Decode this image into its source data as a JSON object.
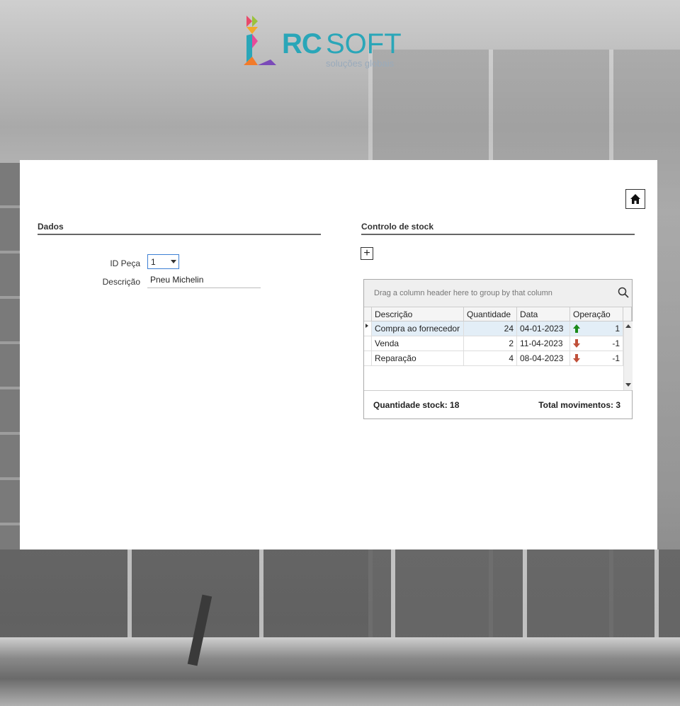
{
  "logo": {
    "rc": "RC",
    "soft": "SOFT",
    "tagline": "soluções globais"
  },
  "left": {
    "section_title": "Dados",
    "id_label": "ID Peça",
    "id_value": "1",
    "descricao_label": "Descrição",
    "descricao_value": "Pneu Michelin"
  },
  "right": {
    "section_title": "Controlo de stock",
    "add_button_label": "+",
    "grid": {
      "group_hint": "Drag a column header here to group by that column",
      "columns": [
        "Descrição",
        "Quantidade",
        "Data",
        "Operação"
      ],
      "rows": [
        {
          "descricao": "Compra ao fornecedor",
          "quantidade": "24",
          "data": "04-01-2023",
          "operacao": "1",
          "direction": "up"
        },
        {
          "descricao": "Venda",
          "quantidade": "2",
          "data": "11-04-2023",
          "operacao": "-1",
          "direction": "down"
        },
        {
          "descricao": "Reparação",
          "quantidade": "4",
          "data": "08-04-2023",
          "operacao": "-1",
          "direction": "down"
        }
      ],
      "footer_stock": "Quantidade stock: 18",
      "footer_total": "Total movimentos: 3"
    }
  },
  "colors": {
    "accent": "#2aa6b8",
    "up_arrow": "#1a8a1a",
    "down_arrow": "#c0503a",
    "selected_row": "#e3eef7"
  },
  "icons": {
    "home": "home-icon",
    "search": "search-icon",
    "add": "plus-icon"
  }
}
